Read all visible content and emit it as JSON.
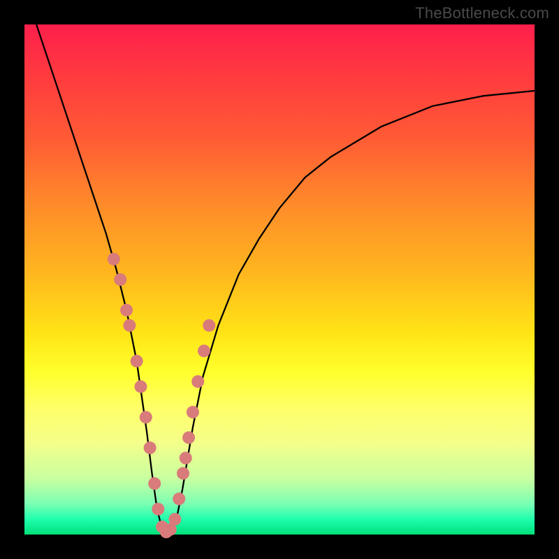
{
  "watermark": "TheBottleneck.com",
  "colors": {
    "frame": "#000000",
    "curve": "#000000",
    "marker_fill": "#d97b7b",
    "marker_stroke": "#c46868"
  },
  "chart_data": {
    "type": "line",
    "title": "",
    "xlabel": "",
    "ylabel": "",
    "xlim": [
      0,
      100
    ],
    "ylim": [
      0,
      100
    ],
    "grid": false,
    "legend": false,
    "series": [
      {
        "name": "bottleneck-curve",
        "x": [
          0,
          2,
          5,
          8,
          10,
          12,
          14,
          16,
          18,
          20,
          22,
          23,
          24,
          25,
          26,
          27,
          28,
          29,
          30,
          31,
          32,
          33,
          35,
          38,
          42,
          46,
          50,
          55,
          60,
          65,
          70,
          75,
          80,
          85,
          90,
          95,
          100
        ],
        "values": [
          108,
          101,
          92,
          83,
          77,
          71,
          65,
          59,
          52,
          44,
          34,
          27,
          20,
          12,
          5,
          1,
          0,
          1,
          4,
          9,
          15,
          21,
          31,
          41,
          51,
          58,
          64,
          70,
          74,
          77,
          80,
          82,
          84,
          85,
          86,
          86.5,
          87
        ]
      }
    ],
    "markers": {
      "name": "salmon-dots",
      "x": [
        17.5,
        18.8,
        20.0,
        20.6,
        22.0,
        22.8,
        23.8,
        24.6,
        25.5,
        26.2,
        27.0,
        27.8,
        28.6,
        29.5,
        30.3,
        31.1,
        31.6,
        32.2,
        33.0,
        34.0,
        35.2,
        36.2
      ],
      "values": [
        54,
        50,
        44,
        41,
        34,
        29,
        23,
        17,
        10,
        5,
        1.5,
        0.5,
        1,
        3,
        7,
        12,
        15,
        19,
        24,
        30,
        36,
        41
      ]
    }
  }
}
